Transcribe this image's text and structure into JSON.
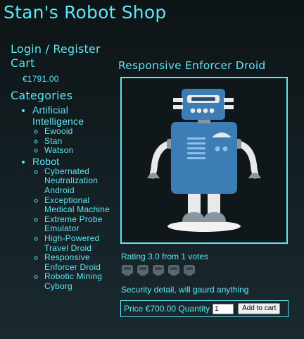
{
  "site": {
    "title": "Stan's Robot Shop"
  },
  "nav": {
    "login_label": "Login / Register",
    "cart_label": "Cart",
    "cart_total": "€1791.00",
    "categories_heading": "Categories",
    "categories": [
      {
        "label": "Artificial Intelligence",
        "items": [
          "Ewooid",
          "Stan",
          "Watson"
        ]
      },
      {
        "label": "Robot",
        "items": [
          "Cybernated Neutralization Android",
          "Exceptional Medical Machine",
          "Extreme Probe Emulator",
          "High-Powered Travel Droid",
          "Responsive Enforcer Droid",
          "Robotic Mining Cyborg"
        ]
      }
    ]
  },
  "product": {
    "title": "Responsive Enforcer Droid",
    "image_icon": "robot-illustration",
    "rating_text": "Rating 3.0 from 1 votes",
    "rating_value": 3.0,
    "vote_icons": 5,
    "description": "Security detail, will gaurd anything",
    "price_text": "Price €700.00 Quantity",
    "quantity": "1",
    "add_to_cart_label": "Add to cart"
  },
  "colors": {
    "accent": "#5ee6f4",
    "background": "#142024",
    "robot_blue": "#3b7db4"
  }
}
